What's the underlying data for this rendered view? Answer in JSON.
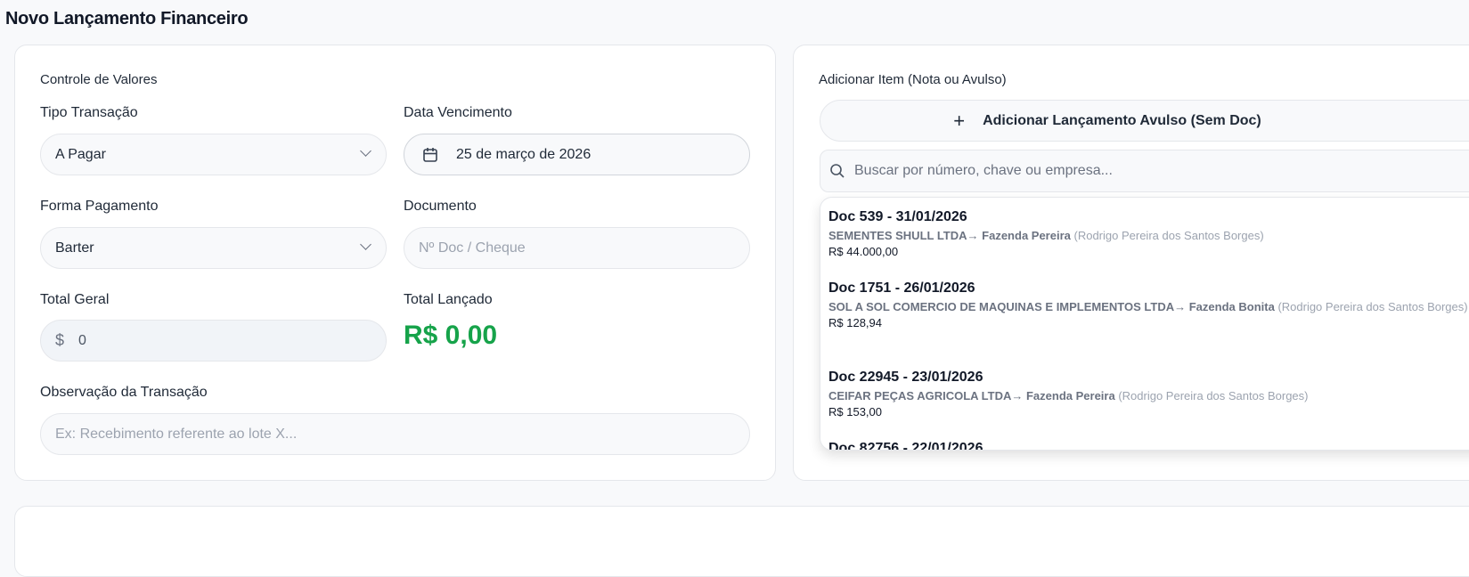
{
  "page_title": "Novo Lançamento Financeiro",
  "left": {
    "section": "Controle de Valores",
    "tipo_label": "Tipo Transação",
    "tipo_value": "A Pagar",
    "venc_label": "Data Vencimento",
    "venc_value": "25 de março de 2026",
    "forma_label": "Forma Pagamento",
    "forma_value": "Barter",
    "doc_label": "Documento",
    "doc_placeholder": "Nº Doc / Cheque",
    "total_label": "Total Geral",
    "total_prefix": "$",
    "total_value": "0",
    "lancado_label": "Total Lançado",
    "lancado_value": "R$ 0,00",
    "obs_label": "Observação da Transação",
    "obs_placeholder": "Ex: Recebimento referente ao lote X..."
  },
  "right": {
    "section": "Adicionar Item (Nota ou Avulso)",
    "add_button": "Adicionar Lançamento Avulso (Sem Doc)",
    "search_placeholder": "Buscar por número, chave ou empresa...",
    "items": [
      {
        "title": "Doc 539 - 31/01/2026",
        "supplier": "SEMENTES SHULL LTDA",
        "arrow": "→",
        "farm": "Fazenda Pereira",
        "owner": "(Rodrigo Pereira dos Santos Borges)",
        "value": "R$ 44.000,00"
      },
      {
        "title": "Doc 1751 - 26/01/2026",
        "supplier": "SOL A SOL COMERCIO DE MAQUINAS E IMPLEMENTOS LTDA",
        "arrow": "→",
        "farm": "Fazenda Bonita",
        "owner": "(Rodrigo Pereira dos Santos Borges)",
        "value": "R$ 128,94"
      },
      {
        "title": "Doc 22945 - 23/01/2026",
        "supplier": "CEIFAR PEÇAS AGRICOLA LTDA",
        "arrow": "→",
        "farm": "Fazenda Pereira",
        "owner": "(Rodrigo Pereira dos Santos Borges)",
        "value": "R$ 153,00"
      },
      {
        "title": "Doc 82756 - 22/01/2026"
      }
    ]
  },
  "colors": {
    "accent_green": "#16a34a"
  }
}
